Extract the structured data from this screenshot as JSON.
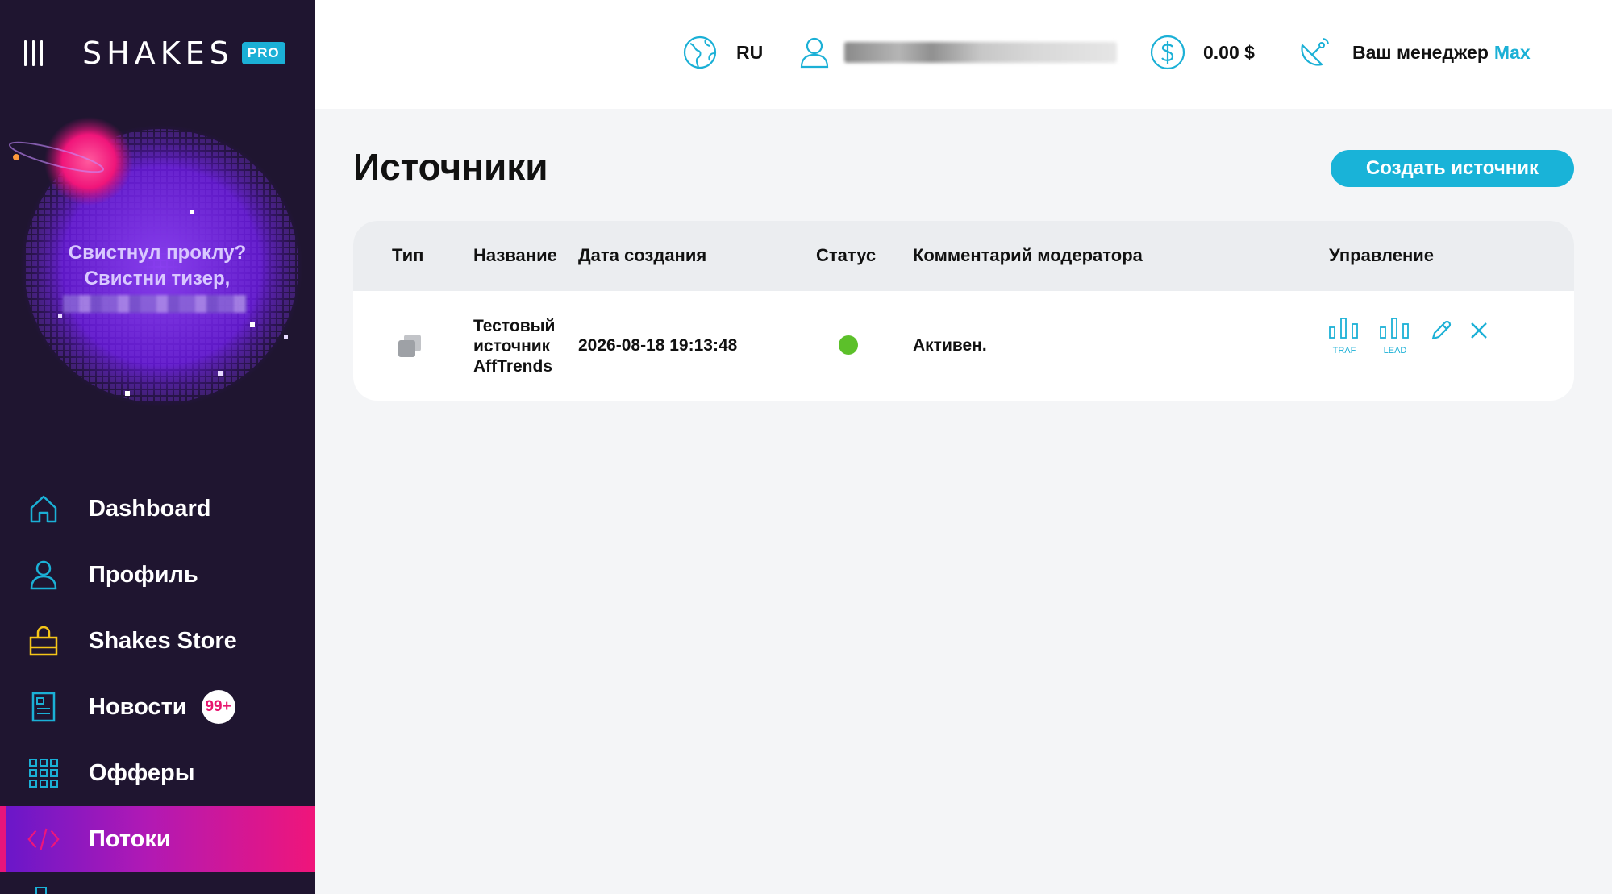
{
  "brand": {
    "logo": "SHAKES",
    "badge": "PRO"
  },
  "promo": {
    "line1": "Свистнул проклу?",
    "line2": "Свистни тизер,"
  },
  "header": {
    "language": "RU",
    "balance": "0.00 $",
    "manager_label": "Ваш менеджер",
    "manager_name": "Max"
  },
  "sidebar": {
    "items": [
      {
        "label": "Dashboard",
        "icon": "home-icon"
      },
      {
        "label": "Профиль",
        "icon": "user-icon"
      },
      {
        "label": "Shakes Store",
        "icon": "shopping-bag-icon"
      },
      {
        "label": "Новости",
        "icon": "news-icon",
        "badge": "99+"
      },
      {
        "label": "Офферы",
        "icon": "grid-icon"
      },
      {
        "label": "Потоки",
        "icon": "code-icon",
        "active": true
      }
    ]
  },
  "page": {
    "title": "Источники",
    "create_button": "Создать источник"
  },
  "table": {
    "headers": {
      "type": "Тип",
      "name": "Название",
      "date": "Дата создания",
      "status": "Статус",
      "comment": "Комментарий модератора",
      "actions": "Управление"
    },
    "rows": [
      {
        "name_line1": "Тестовый",
        "name_line2": "источник",
        "name_line3": "AffTrends",
        "date": "2026-08-18 19:13:48",
        "status_color": "#5cc02a",
        "comment": "Активен.",
        "traf_label": "TRAF",
        "lead_label": "LEAD"
      }
    ]
  },
  "colors": {
    "accent": "#19b3d8",
    "sidebar": "#1f1530",
    "active": "#f0157a"
  }
}
